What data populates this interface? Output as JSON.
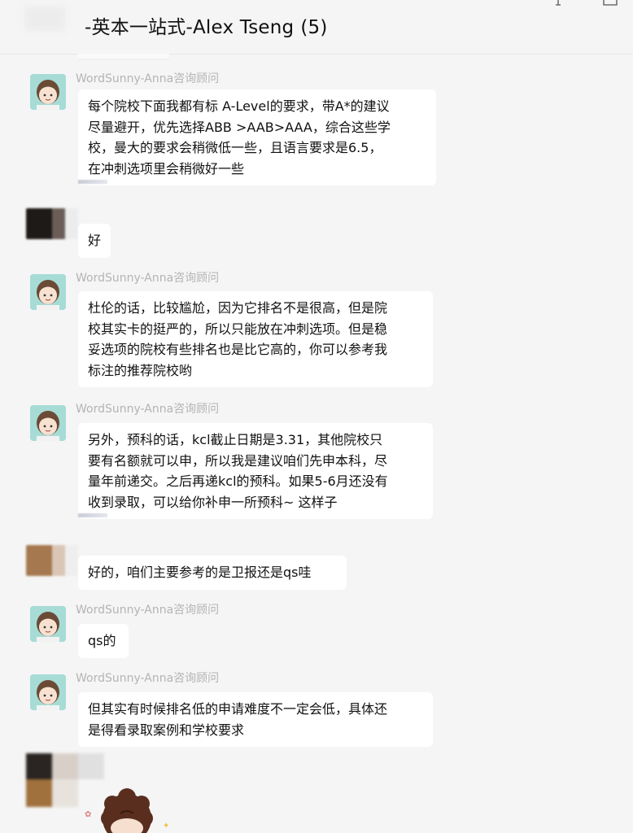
{
  "window": {
    "title": "-英本一站式-Alex Tseng",
    "member_count": "(5)"
  },
  "icons": {
    "pin": "pin-icon",
    "minimize": "minimize-icon",
    "avatar_advisor": "cartoon-girl-avatar",
    "avatar_user": "blurred-user-avatar",
    "sticker": "cartoon-sticker"
  },
  "colors": {
    "background": "#f5f5f5",
    "bubble": "#ffffff",
    "sender_name": "#b4b4b4",
    "avatar_bg": "#a7dcd6"
  },
  "messages": [
    {
      "sender": "WordSunny-Anna咨询顾问",
      "lines": [
        "每个院校下面我都有标 A-Level的要求，带A*的建议",
        "尽量避开，优先选择ABB >AAB>AAA，综合这些学",
        "校，曼大的要求会稍微低一些，且语言要求是6.5，",
        "在冲刺选项里会稍微好一些"
      ]
    },
    {
      "sender": "",
      "lines": [
        "好"
      ]
    },
    {
      "sender": "WordSunny-Anna咨询顾问",
      "lines": [
        "杜伦的话，比较尴尬，因为它排名不是很高，但是院",
        "校其实卡的挺严的，所以只能放在冲刺选项。但是稳",
        "妥选项的院校有些排名也是比它高的，你可以参考我",
        "标注的推荐院校哟"
      ]
    },
    {
      "sender": "WordSunny-Anna咨询顾问",
      "lines": [
        "另外，预科的话，kcl截止日期是3.31，其他院校只",
        "要有名额就可以申，所以我是建议咱们先申本科，尽",
        "量年前递交。之后再递kcl的预科。如果5-6月还没有",
        "收到录取，可以给你补申一所预科~ 这样子"
      ]
    },
    {
      "sender": "",
      "lines": [
        "好的，咱们主要参考的是卫报还是qs哇"
      ]
    },
    {
      "sender": "WordSunny-Anna咨询顾问",
      "lines": [
        "qs的"
      ]
    },
    {
      "sender": "WordSunny-Anna咨询顾问",
      "lines": [
        "但其实有时候排名低的申请难度不一定会低，具体还",
        "是得看录取案例和学校要求"
      ]
    }
  ]
}
